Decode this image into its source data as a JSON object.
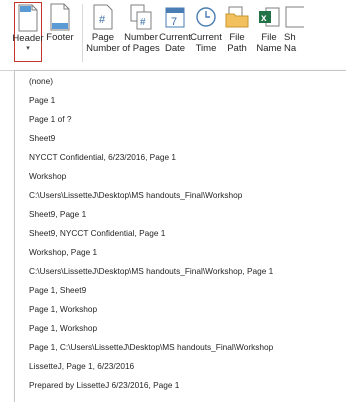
{
  "ribbon": {
    "buttons": [
      {
        "label_line1": "Header",
        "label_line2": "",
        "icon": "header-icon",
        "dropdown": true
      },
      {
        "label_line1": "Footer",
        "label_line2": "",
        "icon": "footer-icon",
        "dropdown": false
      },
      {
        "label_line1": "Page",
        "label_line2": "Number",
        "icon": "page-number-icon"
      },
      {
        "label_line1": "Number",
        "label_line2": "of Pages",
        "icon": "number-of-pages-icon"
      },
      {
        "label_line1": "Current",
        "label_line2": "Date",
        "icon": "current-date-icon"
      },
      {
        "label_line1": "Current",
        "label_line2": "Time",
        "icon": "current-time-icon"
      },
      {
        "label_line1": "File",
        "label_line2": "Path",
        "icon": "file-path-icon"
      },
      {
        "label_line1": "File",
        "label_line2": "Name",
        "icon": "file-name-icon"
      },
      {
        "label_line1": "Sh",
        "label_line2": "Na",
        "icon": "sheet-name-icon"
      }
    ],
    "dropdown_caret": "▾",
    "selected_border_color": "#c0392b"
  },
  "header_menu": {
    "items": [
      "(none)",
      "Page 1",
      "Page 1 of ?",
      "Sheet9",
      "NYCCT Confidential, 6/23/2016, Page 1",
      "Workshop",
      "C:\\Users\\LissetteJ\\Desktop\\MS handouts_Final\\Workshop",
      "Sheet9, Page 1",
      "Sheet9, NYCCT Confidential, Page 1",
      "Workshop, Page 1",
      "C:\\Users\\LissetteJ\\Desktop\\MS handouts_Final\\Workshop, Page 1",
      "Page 1, Sheet9",
      "Page 1, Workshop",
      "Page 1, Workshop",
      "Page 1, C:\\Users\\LissetteJ\\Desktop\\MS handouts_Final\\Workshop",
      "LissetteJ, Page 1, 6/23/2016",
      "Prepared by LissetteJ 6/23/2016, Page 1"
    ]
  }
}
